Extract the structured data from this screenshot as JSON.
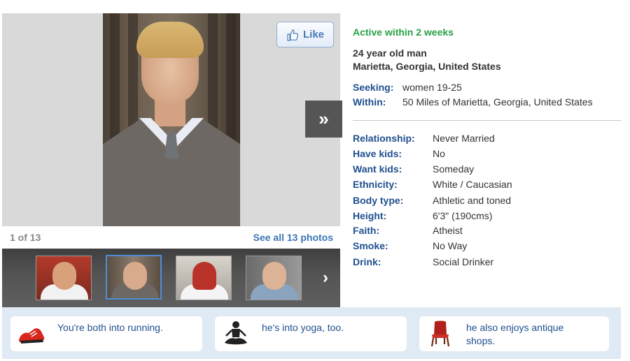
{
  "photo": {
    "like_label": "Like",
    "next_label": "»",
    "counter": "1 of 13",
    "see_all_label": "See all 13 photos",
    "thumb_next_label": "›"
  },
  "profile": {
    "status": "Active within 2 weeks",
    "age_line": "24 year old man",
    "location": "Marietta, Georgia, United States",
    "seeking_label": "Seeking:",
    "seeking_value": "women 19-25",
    "within_label": "Within:",
    "within_value": "50 Miles of Marietta, Georgia, United States"
  },
  "details": [
    {
      "label": "Relationship:",
      "value": "Never Married"
    },
    {
      "label": "Have kids:",
      "value": "No"
    },
    {
      "label": "Want kids:",
      "value": "Someday"
    },
    {
      "label": "Ethnicity:",
      "value": "White / Caucasian"
    },
    {
      "label": "Body type:",
      "value": "Athletic and toned"
    },
    {
      "label": "Height:",
      "value": "6'3\" (190cms)"
    },
    {
      "label": "Faith:",
      "value": "Atheist"
    },
    {
      "label": "Smoke:",
      "value": "No Way"
    },
    {
      "label": "Drink:",
      "value": "Social Drinker"
    }
  ],
  "interests": [
    {
      "icon": "running-shoe-icon",
      "text": "You're both into running."
    },
    {
      "icon": "yoga-icon",
      "text": "he's into yoga, too."
    },
    {
      "icon": "antique-chair-icon",
      "text": "he also enjoys antique shops."
    }
  ],
  "colors": {
    "status_green": "#27a045",
    "label_blue": "#1f4f8e",
    "link_blue": "#3a74b6",
    "interests_bg": "#dfeaf5"
  }
}
